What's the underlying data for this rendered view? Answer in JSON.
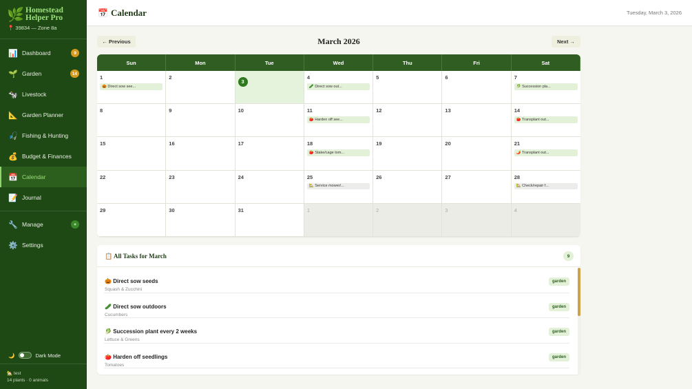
{
  "brand": {
    "logo_icon": "sprout-icon",
    "title": "Homestead Helper Pro",
    "location": "📍 39834 — Zone 8a"
  },
  "nav": {
    "items": [
      {
        "icon": "📊",
        "label": "Dashboard",
        "badge": "9"
      },
      {
        "icon": "🌱",
        "label": "Garden",
        "badge": "14"
      },
      {
        "icon": "🐄",
        "label": "Livestock"
      },
      {
        "icon": "📐",
        "label": "Garden Planner"
      },
      {
        "icon": "🎣",
        "label": "Fishing & Hunting"
      },
      {
        "icon": "💰",
        "label": "Budget & Finances"
      },
      {
        "icon": "📅",
        "label": "Calendar",
        "active": true
      },
      {
        "icon": "📝",
        "label": "Journal"
      }
    ],
    "manage": {
      "icon": "🔧",
      "label": "Manage",
      "badge": "+"
    },
    "settings": {
      "icon": "⚙️",
      "label": "Settings"
    }
  },
  "dark_mode": {
    "icon": "🌙",
    "label": "Dark Mode"
  },
  "footer": {
    "user": "🏡 test",
    "stats": "14 plants · 0 animals"
  },
  "header": {
    "icon": "📅",
    "title": "Calendar",
    "date": "Tuesday, March 3, 2026"
  },
  "calendar": {
    "prev_label": "← Previous",
    "next_label": "Next →",
    "month_title": "March 2026",
    "weekdays": [
      "Sun",
      "Mon",
      "Tue",
      "Wed",
      "Thu",
      "Fri",
      "Sat"
    ],
    "weeks": [
      [
        {
          "day": "1",
          "event": "🎃 Direct sow see..."
        },
        {
          "day": "2"
        },
        {
          "day": "3",
          "today": true
        },
        {
          "day": "4",
          "event": "🥒 Direct sow out..."
        },
        {
          "day": "5"
        },
        {
          "day": "6"
        },
        {
          "day": "7",
          "event": "🥬 Succession pla..."
        }
      ],
      [
        {
          "day": "8"
        },
        {
          "day": "9"
        },
        {
          "day": "10"
        },
        {
          "day": "11",
          "event": "🍅 Harden off see..."
        },
        {
          "day": "12"
        },
        {
          "day": "13"
        },
        {
          "day": "14",
          "event": "🍅 Transplant out..."
        }
      ],
      [
        {
          "day": "15"
        },
        {
          "day": "16"
        },
        {
          "day": "17"
        },
        {
          "day": "18",
          "event": "🍅 Stake/cage tom..."
        },
        {
          "day": "19"
        },
        {
          "day": "20"
        },
        {
          "day": "21",
          "event": "🌶️ Transplant out..."
        }
      ],
      [
        {
          "day": "22"
        },
        {
          "day": "23"
        },
        {
          "day": "24"
        },
        {
          "day": "25",
          "event": "🏡 Service mower/...",
          "grey": true
        },
        {
          "day": "26"
        },
        {
          "day": "27"
        },
        {
          "day": "28",
          "event": "🏡 Check/repair f...",
          "grey": true
        }
      ],
      [
        {
          "day": "29"
        },
        {
          "day": "30"
        },
        {
          "day": "31"
        },
        {
          "day": "1",
          "other": true
        },
        {
          "day": "2",
          "other": true
        },
        {
          "day": "3",
          "other": true
        },
        {
          "day": "4",
          "other": true
        }
      ]
    ]
  },
  "tasks": {
    "icon": "📋",
    "title": "All Tasks for March",
    "count": "9",
    "items": [
      {
        "icon": "🎃",
        "name": "Direct sow seeds",
        "sub": "Squash & Zucchini",
        "tag": "garden"
      },
      {
        "icon": "🥒",
        "name": "Direct sow outdoors",
        "sub": "Cucumbers",
        "tag": "garden"
      },
      {
        "icon": "🥬",
        "name": "Succession plant every 2 weeks",
        "sub": "Lettuce & Greens",
        "tag": "garden"
      },
      {
        "icon": "🍅",
        "name": "Harden off seedlings",
        "sub": "Tomatoes",
        "tag": "garden"
      }
    ]
  }
}
